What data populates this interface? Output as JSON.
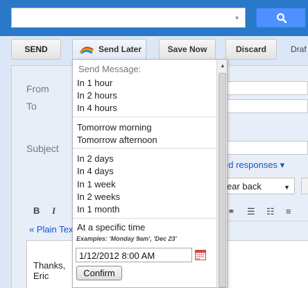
{
  "toolbar": {
    "send": "SEND",
    "send_later": "Send Later",
    "save_now": "Save Now",
    "discard": "Discard",
    "drafts_fragment": "Draf"
  },
  "fields": {
    "from": "From",
    "to": "To",
    "subject": "Subject"
  },
  "canned_responses_fragment": "ed responses ▾",
  "reply_select_fragment": "ear back",
  "formatting": {
    "bold": "B",
    "italic": "I",
    "plain_text_link": "« Plain Tex"
  },
  "signature": {
    "line1": "Thanks,",
    "line2": "Eric"
  },
  "send_later_menu": {
    "header": "Send Message:",
    "group1": [
      "In 1 hour",
      "In 2 hours",
      "In 4 hours"
    ],
    "group2": [
      "Tomorrow morning",
      "Tomorrow afternoon"
    ],
    "group3": [
      "In 2 days",
      "In 4 days",
      "In 1 week",
      "In 2 weeks",
      "In 1 month"
    ],
    "specific_time": "At a specific time",
    "examples": "Examples: 'Monday 9am', 'Dec 23'",
    "date_value": "1/12/2012 8:00 AM",
    "confirm": "Confirm"
  },
  "colors": {
    "header_blue": "#2a78c8",
    "search_button": "#4d90fe",
    "link": "#1155cc"
  }
}
